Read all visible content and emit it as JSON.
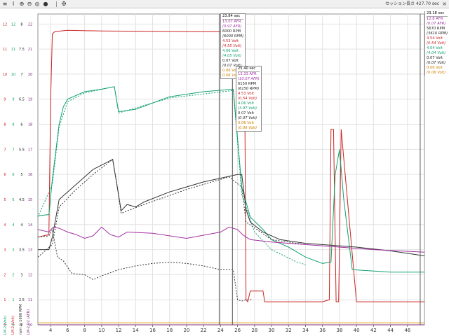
{
  "toolbar": {
    "icons": [
      "menu-icon",
      "pointer-icon",
      "zoom-in-icon",
      "zoom-out-icon",
      "zoom-fit-icon",
      "record-icon",
      "pin-icon"
    ],
    "glyphs": [
      "≡",
      "I",
      "⊕",
      "⊖",
      "◎",
      "●",
      "✠"
    ],
    "status": "セッション長さ 427.70 sec",
    "close": "×"
  },
  "chart_data": {
    "type": "line",
    "title": "",
    "xlabel": "",
    "ylabel": "",
    "xlim": [
      2.5,
      48
    ],
    "x_ticks": [
      4,
      6,
      8,
      10,
      12,
      14,
      16,
      18,
      20,
      22,
      24,
      26,
      28,
      30,
      32,
      34,
      36,
      38,
      40,
      42,
      44,
      46
    ],
    "grid": true,
    "axis_labels": [
      {
        "text": "LM-2 (Volt)",
        "color": "#10a070"
      },
      {
        "text": "LM-2 (Volt)",
        "color": "#cc2222"
      },
      {
        "text": "rpm to 1000 RPM",
        "color": "#222222"
      },
      {
        "text": "LM-2 O2 (AFR)",
        "color": "#7a2a7a"
      }
    ],
    "y_tick_columns": [
      {
        "color": "#cc2222",
        "labels": [
          "0",
          "1",
          "2",
          "3",
          "4",
          "5",
          "6",
          "7",
          "8",
          "9",
          "10",
          "11",
          "12"
        ]
      },
      {
        "color": "#10a070",
        "labels": [
          "0",
          "1",
          "2",
          "3",
          "4",
          "5",
          "6",
          "7",
          "8",
          "9",
          "10",
          "11",
          "12"
        ]
      },
      {
        "color": "#222222",
        "labels": [
          "2",
          "2.5",
          "3",
          "3.5",
          "4",
          "4.5",
          "5",
          "5.5",
          "6",
          "6.5",
          "7",
          "7.5",
          "8"
        ]
      },
      {
        "color": "#7a2a7a",
        "labels": [
          "10",
          "11",
          "12",
          "13",
          "14",
          "15",
          "16",
          "17",
          "18",
          "19",
          "20",
          "21",
          "22"
        ]
      }
    ],
    "cursors": [
      23.84,
      25.4,
      47.5
    ],
    "series": [
      {
        "color": "#cc2222",
        "dashed": false,
        "x": [
          2.5,
          3.8,
          4.0,
          4.2,
          4.5,
          6,
          10,
          20,
          26,
          26.8,
          27.0,
          27.2,
          27.5,
          29,
          29.2,
          36,
          36.8,
          37.0,
          37.3,
          37.6,
          37.9,
          38.2,
          40,
          48
        ],
        "y": [
          3.5,
          3.6,
          9.0,
          11.6,
          11.7,
          11.75,
          11.72,
          11.7,
          11.7,
          11.65,
          1.0,
          0.92,
          1.35,
          1.35,
          0.92,
          0.92,
          1.0,
          7.8,
          7.8,
          0.92,
          0.92,
          7.8,
          0.92,
          0.92
        ]
      },
      {
        "color": "#10a070",
        "dashed": false,
        "x": [
          2.5,
          3.8,
          4.2,
          5,
          5.5,
          6,
          8,
          10,
          11.5,
          12,
          14,
          18,
          22,
          25.5,
          26.5,
          27.5,
          29,
          30,
          32,
          34,
          36,
          37,
          37.5,
          38,
          38.5,
          39.5,
          44,
          48
        ],
        "y": [
          4.35,
          4.4,
          5.8,
          8.0,
          8.7,
          9.0,
          9.3,
          9.4,
          9.5,
          8.5,
          8.6,
          9.1,
          9.3,
          9.4,
          5.5,
          4.3,
          3.8,
          3.4,
          3.1,
          2.7,
          2.45,
          2.5,
          6.0,
          7.0,
          5.0,
          2.2,
          2.1,
          2.1
        ]
      },
      {
        "color": "#10a070",
        "dashed": true,
        "x": [
          2.5,
          4.2,
          5,
          6,
          8,
          11.5,
          12,
          18,
          25.5,
          26.5,
          28,
          30,
          33,
          34
        ],
        "y": [
          4.3,
          5.6,
          7.9,
          8.9,
          9.25,
          9.5,
          8.45,
          9.05,
          9.35,
          5.2,
          3.7,
          3.0,
          2.5,
          2.4
        ]
      },
      {
        "color": "#333333",
        "dashed": false,
        "x": [
          2.5,
          3.8,
          4.2,
          5,
          7,
          9,
          11.3,
          11.7,
          12.3,
          13,
          14,
          15,
          18,
          22,
          26,
          26.5,
          27,
          27.5,
          29,
          31,
          34,
          40,
          44,
          48
        ],
        "y": [
          3.0,
          3.0,
          3.5,
          5.0,
          5.6,
          6.2,
          6.6,
          5.8,
          4.55,
          4.8,
          4.7,
          4.9,
          5.3,
          5.7,
          6.0,
          6.0,
          4.6,
          4.1,
          3.7,
          3.4,
          3.25,
          3.1,
          2.95,
          2.75
        ]
      },
      {
        "color": "#333333",
        "dashed": true,
        "x": [
          2.5,
          4.2,
          5,
          7,
          9,
          11.3,
          11.8,
          12.3,
          15,
          20,
          25,
          26.5,
          27,
          30,
          34
        ],
        "y": [
          2.7,
          3.2,
          4.7,
          5.4,
          6.0,
          6.6,
          5.6,
          4.45,
          4.8,
          5.4,
          5.9,
          5.5,
          4.1,
          3.4,
          3.2
        ]
      },
      {
        "color": "#a030a0",
        "dashed": false,
        "x": [
          2.5,
          3.8,
          4.3,
          5,
          6,
          7,
          8,
          9,
          10,
          10.5,
          11,
          11.5,
          12,
          13,
          16,
          20,
          24,
          25,
          26,
          26.6,
          27,
          27.5,
          30,
          34,
          38,
          42,
          48
        ],
        "y": [
          3.8,
          3.7,
          3.9,
          3.85,
          3.7,
          3.6,
          3.45,
          3.55,
          3.9,
          3.75,
          3.6,
          3.55,
          3.5,
          3.7,
          3.65,
          3.45,
          3.7,
          3.9,
          3.8,
          3.6,
          3.5,
          3.4,
          3.3,
          3.2,
          3.1,
          3.0,
          2.9
        ]
      },
      {
        "color": "#333333",
        "dashed": true,
        "x": [
          2.5,
          3.8,
          4.2,
          4.8,
          5.5,
          6.5,
          8,
          9,
          10,
          12,
          14,
          16,
          18,
          20,
          22,
          24,
          25.5,
          26,
          26.5,
          27,
          27.8
        ],
        "y": [
          3.5,
          3.55,
          3.8,
          2.7,
          2.55,
          2.05,
          2.0,
          1.8,
          1.95,
          2.2,
          2.35,
          2.45,
          2.5,
          2.45,
          2.35,
          2.2,
          2.2,
          1.0,
          0.95,
          1.0,
          1.0
        ]
      },
      {
        "color": "#7a2a7a",
        "dashed": false,
        "x": [
          2.5,
          26.5,
          48
        ],
        "y": [
          0.0,
          0.0,
          0.0
        ]
      },
      {
        "color": "#e0a020",
        "dashed": false,
        "x": [
          2.5,
          26.5,
          48
        ],
        "y": [
          0.08,
          0.08,
          0.08
        ]
      }
    ]
  },
  "cursor_boxes": [
    {
      "time": "23.84 sec",
      "lines": [
        {
          "text": "13.07 AFR",
          "color": "#a030a0"
        },
        {
          "text": "(0.97 AFR)",
          "color": "#a030a0",
          "italic": true
        },
        {
          "text": "6000 RPM",
          "color": "#222222"
        },
        {
          "text": "(6000 RPM)",
          "color": "#222222",
          "italic": true
        },
        {
          "text": "4.53 Volt",
          "color": "#cc2222"
        },
        {
          "text": "(4.55 Volt)",
          "color": "#cc2222",
          "italic": true
        },
        {
          "text": "4.06 Volt",
          "color": "#10a070"
        },
        {
          "text": "(4.05 Volt)",
          "color": "#10a070",
          "italic": true
        },
        {
          "text": "0.07 Volt",
          "color": "#222222"
        },
        {
          "text": "(0.07 Volt)",
          "color": "#222222",
          "italic": true
        },
        {
          "text": "0.06 Volt",
          "color": "#d08000"
        },
        {
          "text": "0.06 Volt",
          "color": "#d08000",
          "italic": true
        }
      ]
    },
    {
      "time": "25.40 sec",
      "lines": [
        {
          "text": "13.33 AFR",
          "color": "#a030a0"
        },
        {
          "text": "(10.07 AFR)",
          "color": "#a030a0",
          "italic": true
        },
        {
          "text": "6150 RPM",
          "color": "#222222"
        },
        {
          "text": "(6150 RPM)",
          "color": "#222222",
          "italic": true
        },
        {
          "text": "4.53 Volt",
          "color": "#cc2222"
        },
        {
          "text": "(0.54 Volt)",
          "color": "#cc2222",
          "italic": true
        },
        {
          "text": "4.06 Volt",
          "color": "#10a070"
        },
        {
          "text": "(3.97 Volt)",
          "color": "#10a070",
          "italic": true
        },
        {
          "text": "0.07 Volt",
          "color": "#222222"
        },
        {
          "text": "(0.07 Volt)",
          "color": "#222222",
          "italic": true
        },
        {
          "text": "0.06 Volt",
          "color": "#d08000"
        },
        {
          "text": "(0.06 Volt)",
          "color": "#d08000",
          "italic": true
        }
      ]
    },
    {
      "time": "23.18 sec",
      "lines": [
        {
          "text": "12.8 AFR",
          "color": "#a030a0"
        },
        {
          "text": "(0.07 AFR)",
          "color": "#a030a0",
          "italic": true
        },
        {
          "text": "5670 RPM",
          "color": "#222222"
        },
        {
          "text": "(3610 RPM)",
          "color": "#222222",
          "italic": true
        },
        {
          "text": "4.54 Volt",
          "color": "#cc2222"
        },
        {
          "text": "(0.54 Volt)",
          "color": "#cc2222",
          "italic": true
        },
        {
          "text": "4.04 Volt",
          "color": "#10a070"
        },
        {
          "text": "(4.04 Volt)",
          "color": "#10a070",
          "italic": true
        },
        {
          "text": "0.07 Volt",
          "color": "#222222"
        },
        {
          "text": "(0.07 Volt)",
          "color": "#222222",
          "italic": true
        },
        {
          "text": "0.06 Volt",
          "color": "#d08000"
        },
        {
          "text": "(0.06 Volt)",
          "color": "#d08000",
          "italic": true
        }
      ]
    }
  ]
}
